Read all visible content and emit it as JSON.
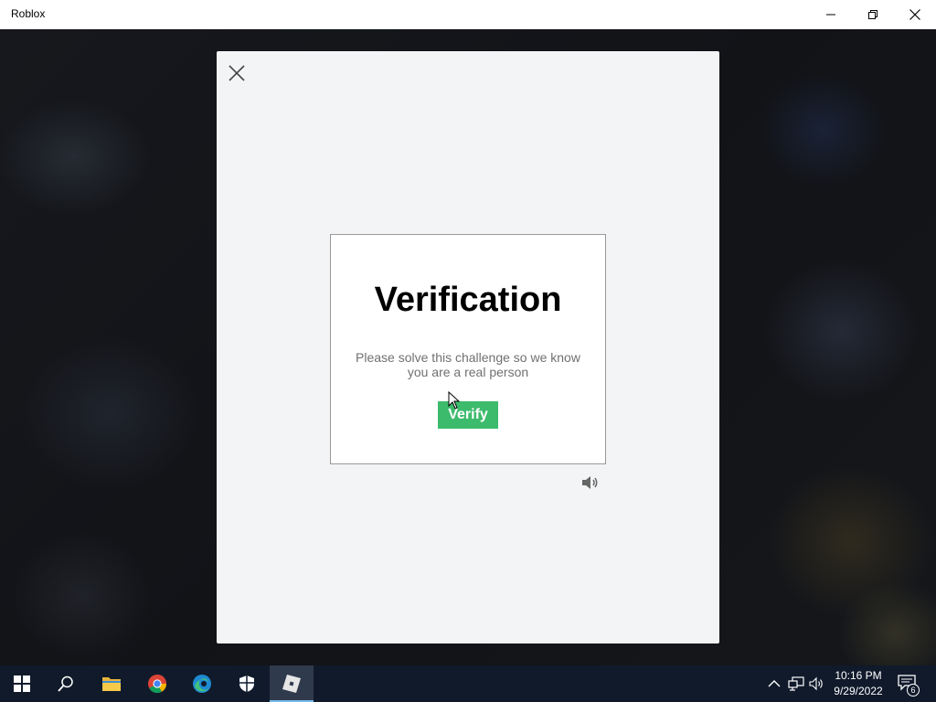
{
  "window": {
    "title": "Roblox",
    "controls": [
      "minimize-icon",
      "restore-icon",
      "close-icon"
    ]
  },
  "modal": {
    "close_icon": "close-icon",
    "card": {
      "title": "Verification",
      "description": "Please solve this challenge so we know you are a real person",
      "verify_label": "Verify"
    },
    "audio_icon": "speaker-icon"
  },
  "colors": {
    "verify_button": "#3dbb6c",
    "modal_bg": "#f2f4f5",
    "taskbar": "#101a2b"
  },
  "taskbar": {
    "items": [
      "windows-start-icon",
      "search-icon",
      "file-explorer-icon",
      "chrome-icon",
      "edge-icon",
      "windows-security-icon",
      "roblox-icon"
    ],
    "active_item": "roblox-icon",
    "tray": [
      "chevron-up-icon",
      "network-icon",
      "volume-icon"
    ],
    "clock": {
      "time": "10:16 PM",
      "date": "9/29/2022"
    },
    "notifications": {
      "count": "6"
    }
  }
}
